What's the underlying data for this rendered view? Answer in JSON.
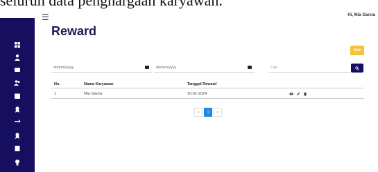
{
  "caption": "seluruh data penghargaan karyawan.",
  "header": {
    "greeting": "Hi, Mia Garcia",
    "menu_icon": "hamburger-icon"
  },
  "page": {
    "title": "Reward",
    "add_label": "Add"
  },
  "filters": {
    "date_from_placeholder": "dd/mm/yyyy",
    "date_to_placeholder": "dd/mm/yyyy",
    "search_placeholder": "Cari"
  },
  "sidebar": {
    "icons": [
      "dashboard-icon",
      "user-icon",
      "inbox-icon",
      "users-icon",
      "calendar-icon",
      "award-icon",
      "transfer-icon",
      "award-icon-2",
      "document-icon",
      "lightbulb-icon"
    ]
  },
  "table": {
    "headers": [
      "No.",
      "Nama Karyawan",
      "Tanggal Reward"
    ],
    "rows": [
      {
        "no": "1",
        "name": "Mia Garcia",
        "date": "10-01-2024",
        "actions": [
          "view-icon",
          "edit-icon",
          "delete-icon"
        ]
      }
    ]
  },
  "pagination": {
    "prev": "<",
    "current": "1",
    "next": ">"
  },
  "colors": {
    "sidebar": "#160e5e",
    "add_button": "#f7c23a",
    "page_active": "#1e88e5"
  }
}
